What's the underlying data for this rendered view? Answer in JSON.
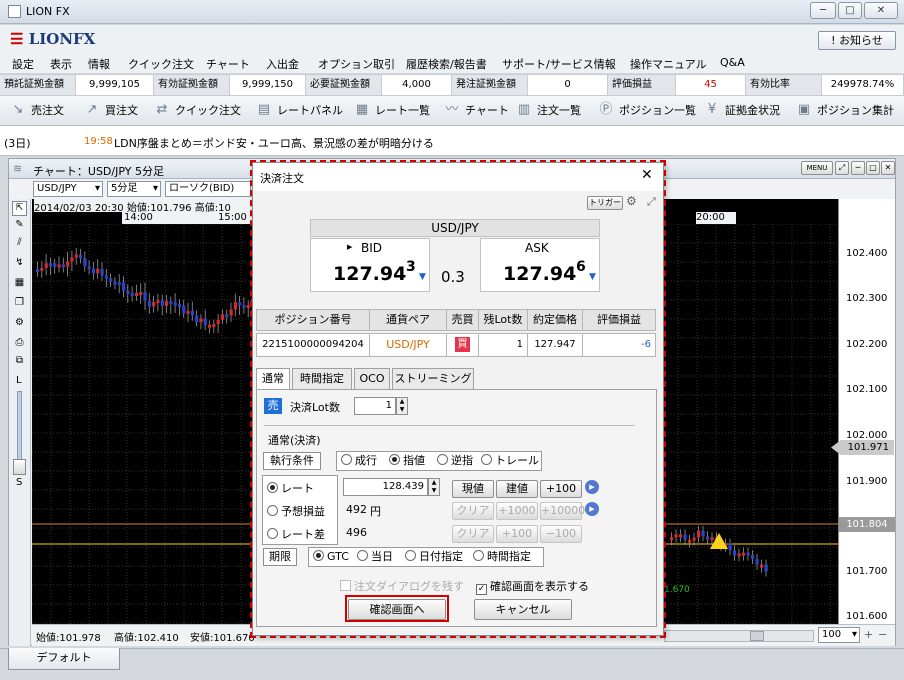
{
  "window": {
    "title": "LION FX",
    "min": "─",
    "max": "□",
    "close": "✕"
  },
  "brand": {
    "logo": "LIONFX",
    "notice_button": "! お知らせ"
  },
  "menu": [
    "設定",
    "表示",
    "情報",
    "クイック注文",
    "チャート",
    "入出金",
    "オプション取引",
    "履歴検索/報告書",
    "サポート/サービス情報",
    "操作マニュアル",
    "Q&A"
  ],
  "margin": [
    {
      "label": "預託証拠金額",
      "value": "9,999,105"
    },
    {
      "label": "有効証拠金額",
      "value": "9,999,150"
    },
    {
      "label": "必要証拠金額",
      "value": "4,000"
    },
    {
      "label": "発注証拠金額",
      "value": "0"
    },
    {
      "label": "評価損益",
      "value": "45"
    },
    {
      "label": "有効比率",
      "value": "249978.74%"
    }
  ],
  "toolbar": [
    "売注文",
    "買注文",
    "クイック注文",
    "レートパネル",
    "レート一覧",
    "チャート",
    "注文一覧",
    "ポジション一覧",
    "証拠金状況",
    "ポジション集計"
  ],
  "news": {
    "prefix": "(3日)",
    "time": "19:58",
    "text": "LDN序盤まとめ＝ポンド安・ユーロ高、景況感の差が明暗分ける"
  },
  "chart": {
    "caption": "チャート：USD/JPY 5分足",
    "menu_button": "MENU",
    "pair": "USD/JPY",
    "interval": "5分足",
    "type": "ローソク(BID)",
    "info_time": "2014/02/03 20:30",
    "info_open": "始値:101.796",
    "info_high": "高値:10",
    "time_labels": [
      "14:00",
      "15:00",
      "20:00"
    ],
    "y_labels": [
      "102.400",
      "102.300",
      "102.200",
      "102.100",
      "102.000",
      "101.900",
      "101.800",
      "101.700",
      "101.600"
    ],
    "marker_bid": "101.971",
    "marker_line": "101.804",
    "low_label": "1.670",
    "footer_open": "始値:101.978",
    "footer_high": "高値:102.410",
    "footer_low": "安値:101.670",
    "zoom": "100",
    "left_letters": [
      "L",
      "S"
    ],
    "colors": {
      "up": "#d42a2a",
      "down": "#2b43c7",
      "hline": "#d9862a",
      "yline": "#ffd21a"
    }
  },
  "tab_default": "デフォルト",
  "dialog": {
    "title": "決済注文",
    "trigger": "トリガー",
    "pair": "USD/JPY",
    "bid_label": "BID",
    "bid_main": "127.94",
    "bid_pip": "3",
    "spread": "0.3",
    "ask_label": "ASK",
    "ask_main": "127.94",
    "ask_pip": "6",
    "table_headers": [
      "ポジション番号",
      "通貨ペア",
      "売買",
      "残Lot数",
      "約定価格",
      "評価損益"
    ],
    "row": {
      "id": "2215100000094204",
      "pair": "USD/JPY",
      "side": "買",
      "lots": "1",
      "price": "127.947",
      "pl": "-6"
    },
    "tabs": [
      "通常",
      "時間指定",
      "OCO",
      "ストリーミング"
    ],
    "sell_badge": "売",
    "lot_label": "決済Lot数",
    "lot_value": "1",
    "section_label": "通常(決済)",
    "exec_label": "執行条件",
    "exec_options": [
      "成行",
      "指値",
      "逆指",
      "トレール"
    ],
    "rate_options": [
      "レート",
      "予想損益",
      "レート差"
    ],
    "rate_value": "128.439",
    "pl_value": "492",
    "pl_unit": "円",
    "diff_value": "496",
    "btn_current": "現値",
    "btn_build": "建値",
    "btn_plus100": "+100",
    "btn_clear": "クリア",
    "btn_p1000": "+1000",
    "btn_p10000": "+10000",
    "btn_m100": "−100",
    "btn_p100b": "+100",
    "period_label": "期限",
    "period_options": [
      "GTC",
      "当日",
      "日付指定",
      "時間指定"
    ],
    "keep_dialog": "注文ダイアログを残す",
    "show_confirm": "確認画面を表示する",
    "confirm_button": "確認画面へ",
    "cancel_button": "キャンセル"
  }
}
